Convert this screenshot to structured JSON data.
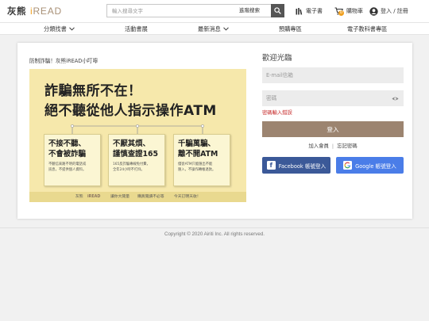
{
  "brand": {
    "name_cn": "灰熊",
    "name_en_first": "i",
    "name_en_rest": "READ",
    "accent": "#f0a020",
    "text_color": "#a89076"
  },
  "search": {
    "placeholder": "輸入搜尋文字",
    "advanced_label": "進階搜索",
    "icon": "search-icon"
  },
  "header_links": {
    "ebook": {
      "label": "電子書",
      "icon": "library-icon"
    },
    "cart": {
      "label": "購物車",
      "icon": "cart-icon",
      "badge": "0"
    },
    "account": {
      "label": "登入 / 註冊",
      "icon": "user-icon"
    }
  },
  "nav": [
    {
      "label": "分類找書",
      "dropdown": true
    },
    {
      "label": "活動書展",
      "dropdown": false
    },
    {
      "label": "最新消息",
      "dropdown": true
    },
    {
      "label": "預購專區",
      "dropdown": false
    },
    {
      "label": "電子教科書專區",
      "dropdown": false
    }
  ],
  "notice": {
    "title": "防制詐騙！灰熊iREAD小叮嚀",
    "banner": {
      "headline1": "詐騙無所不在！",
      "headline2": "絕不聽從他人指示操作ATM",
      "notes": [
        {
          "title": "不接不聽、\n不會被詐騙",
          "body": "不聽信來路不明的電話或\n訊息，不提供個人資料。"
        },
        {
          "title": "不厭其煩、\n謹慎查證165",
          "body": "165反詐騙專線免付費，\n全年24小時不打烊。"
        },
        {
          "title": "千騙萬騙、\n離不開ATM",
          "body": "僅從ATM只能匯出不能\n匯入，不操作轉帳退款。"
        }
      ],
      "footer": {
        "brand_cn": "灰熊",
        "brand_en": "iREAD",
        "slogan1": "讓你大閱量",
        "slogan2": "購買閱讀不必等",
        "slogan3": "今天訂明天收！"
      },
      "bg_color": "#f6e8ab"
    }
  },
  "login": {
    "title": "歡迎光臨",
    "email_placeholder": "E-mail信箱",
    "password_placeholder": "密碼",
    "error": "密碼輸入錯誤",
    "submit_label": "登入",
    "join_label": "加入會員",
    "separator": "|",
    "forgot_label": "忘記密碼",
    "facebook_label": "Facebook 帳號登入",
    "google_label": "Google 帳號登入",
    "button_color": "#9c8470",
    "facebook_color": "#3b5998",
    "google_color": "#4a7de8",
    "error_color": "#c62828"
  },
  "footer": {
    "copyright": "Copyright © 2020 Airiti Inc. All rights reserved."
  }
}
